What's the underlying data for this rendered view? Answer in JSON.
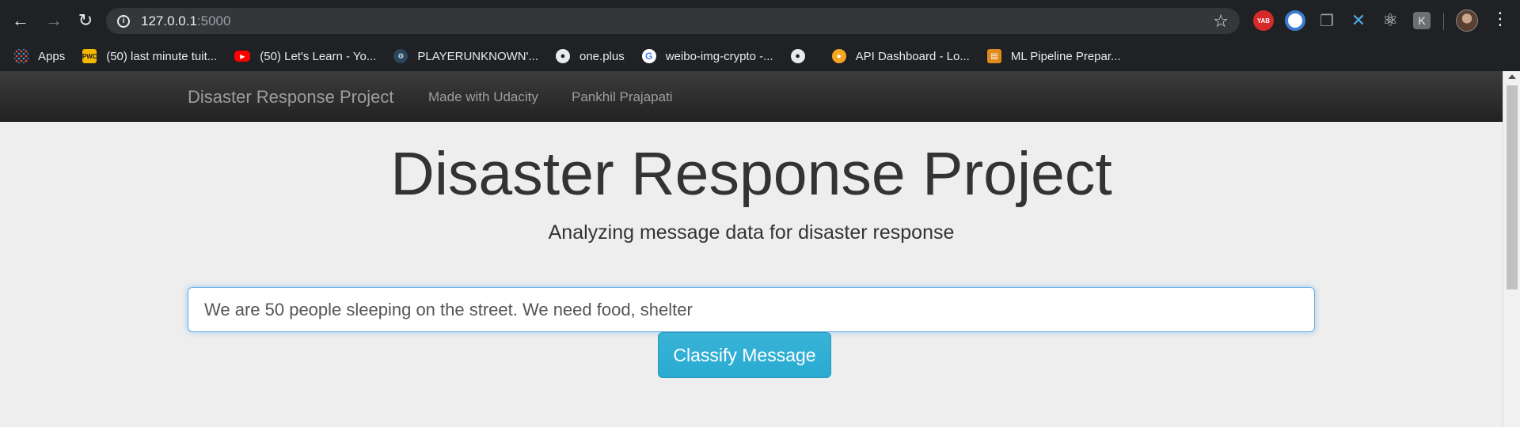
{
  "browser": {
    "url_host": "127.0.0.1",
    "url_port": ":5000",
    "bookmarks": [
      {
        "label": "Apps",
        "icon": "apps-grid-icon"
      },
      {
        "label": "(50) last minute tuit...",
        "icon": "pwc-icon"
      },
      {
        "label": "(50) Let's Learn - Yo...",
        "icon": "youtube-icon"
      },
      {
        "label": "PLAYERUNKNOWN'...",
        "icon": "steam-icon"
      },
      {
        "label": "one.plus",
        "icon": "globe-icon"
      },
      {
        "label": "weibo-img-crypto -...",
        "icon": "google-icon"
      },
      {
        "label": "",
        "icon": "globe-icon"
      },
      {
        "label": "API Dashboard - Lo...",
        "icon": "api-dashboard-icon"
      },
      {
        "label": "ML Pipeline Prepar...",
        "icon": "notebook-icon"
      }
    ],
    "extensions": {
      "yab_label": "YAB",
      "k_label": "K"
    }
  },
  "navbar": {
    "brand": "Disaster Response Project",
    "links": [
      "Made with Udacity",
      "Pankhil Prajapati"
    ]
  },
  "jumbotron": {
    "title": "Disaster Response Project",
    "subtitle": "Analyzing message data for disaster response"
  },
  "form": {
    "message_value": "We are 50 people sleeping on the street. We need food, shelter",
    "button_label": "Classify Message"
  },
  "colors": {
    "browser_chrome": "#202124",
    "navbar_bg": "#222222",
    "page_bg": "#eeeeee",
    "button_bg": "#2aabd2",
    "input_focus": "#66afe9"
  }
}
